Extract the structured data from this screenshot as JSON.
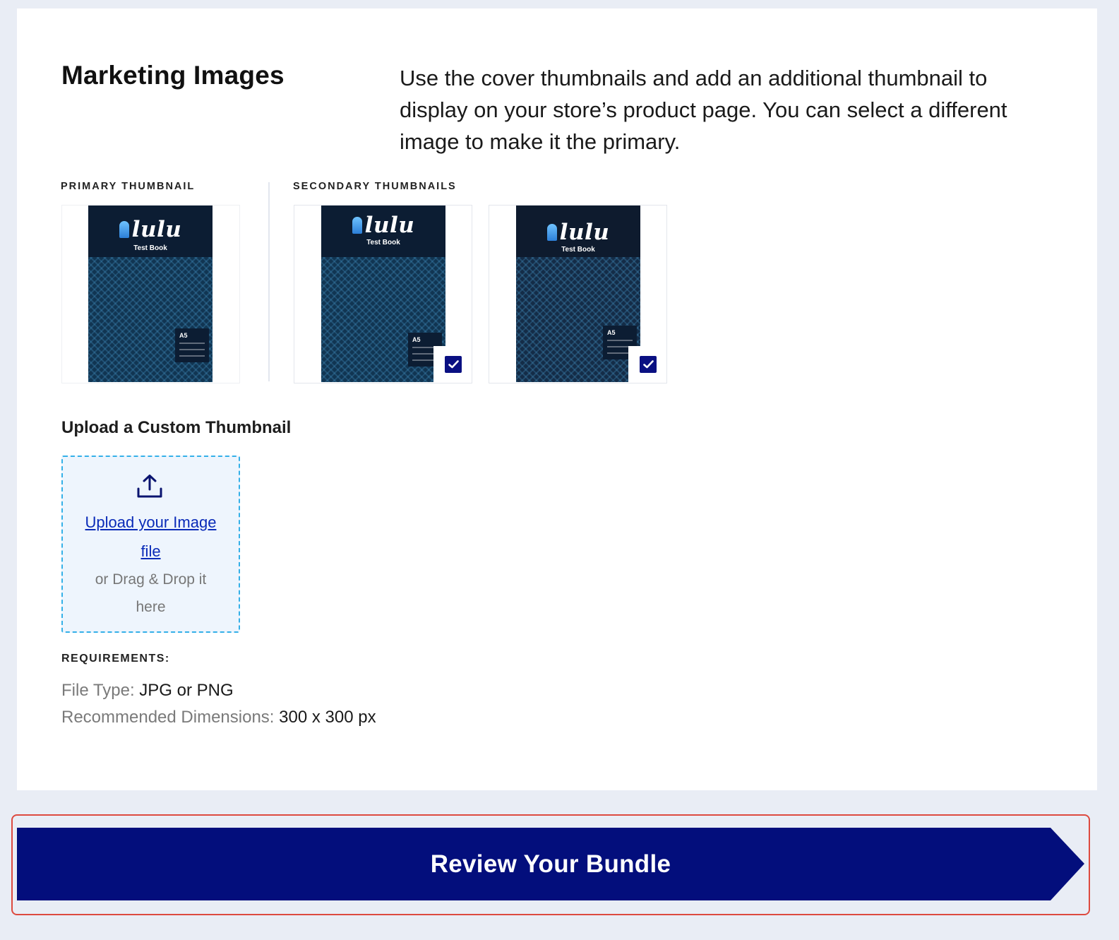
{
  "section": {
    "title": "Marketing Images",
    "description": "Use the cover thumbnails and add an additional thumbnail to display on your store’s product page. You can select a different image to make it the primary."
  },
  "thumbnails": {
    "primary_label": "PRIMARY THUMBNAIL",
    "secondary_label": "SECONDARY THUMBNAILS",
    "cover_logo": "lulu",
    "cover_subtitle": "Test Book",
    "cover_size_label": "A5",
    "secondary_selected": [
      true,
      true
    ]
  },
  "upload": {
    "heading": "Upload a Custom Thumbnail",
    "link_text": "Upload your Image file",
    "alt_text": "or Drag & Drop it here"
  },
  "requirements": {
    "label": "REQUIREMENTS:",
    "file_type_label": "File Type:",
    "file_type_value": "JPG or PNG",
    "dimensions_label": "Recommended Dimensions:",
    "dimensions_value": "300 x 300 px"
  },
  "cta": {
    "label": "Review Your Bundle"
  },
  "colors": {
    "brand_navy": "#030e7c",
    "upload_border": "#34b0e8",
    "highlight_border": "#dd4a3f"
  }
}
